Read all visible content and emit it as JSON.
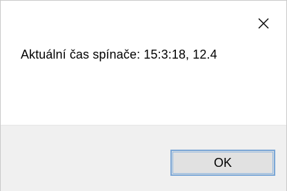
{
  "dialog": {
    "message": "Aktuální čas spínače: 15:3:18, 12.4",
    "close_icon": "close-icon",
    "ok_label": "OK"
  },
  "colors": {
    "footer_bg": "#f0f0f0",
    "button_bg": "#e1e1e1",
    "button_border_focus": "#7aa6d6"
  }
}
